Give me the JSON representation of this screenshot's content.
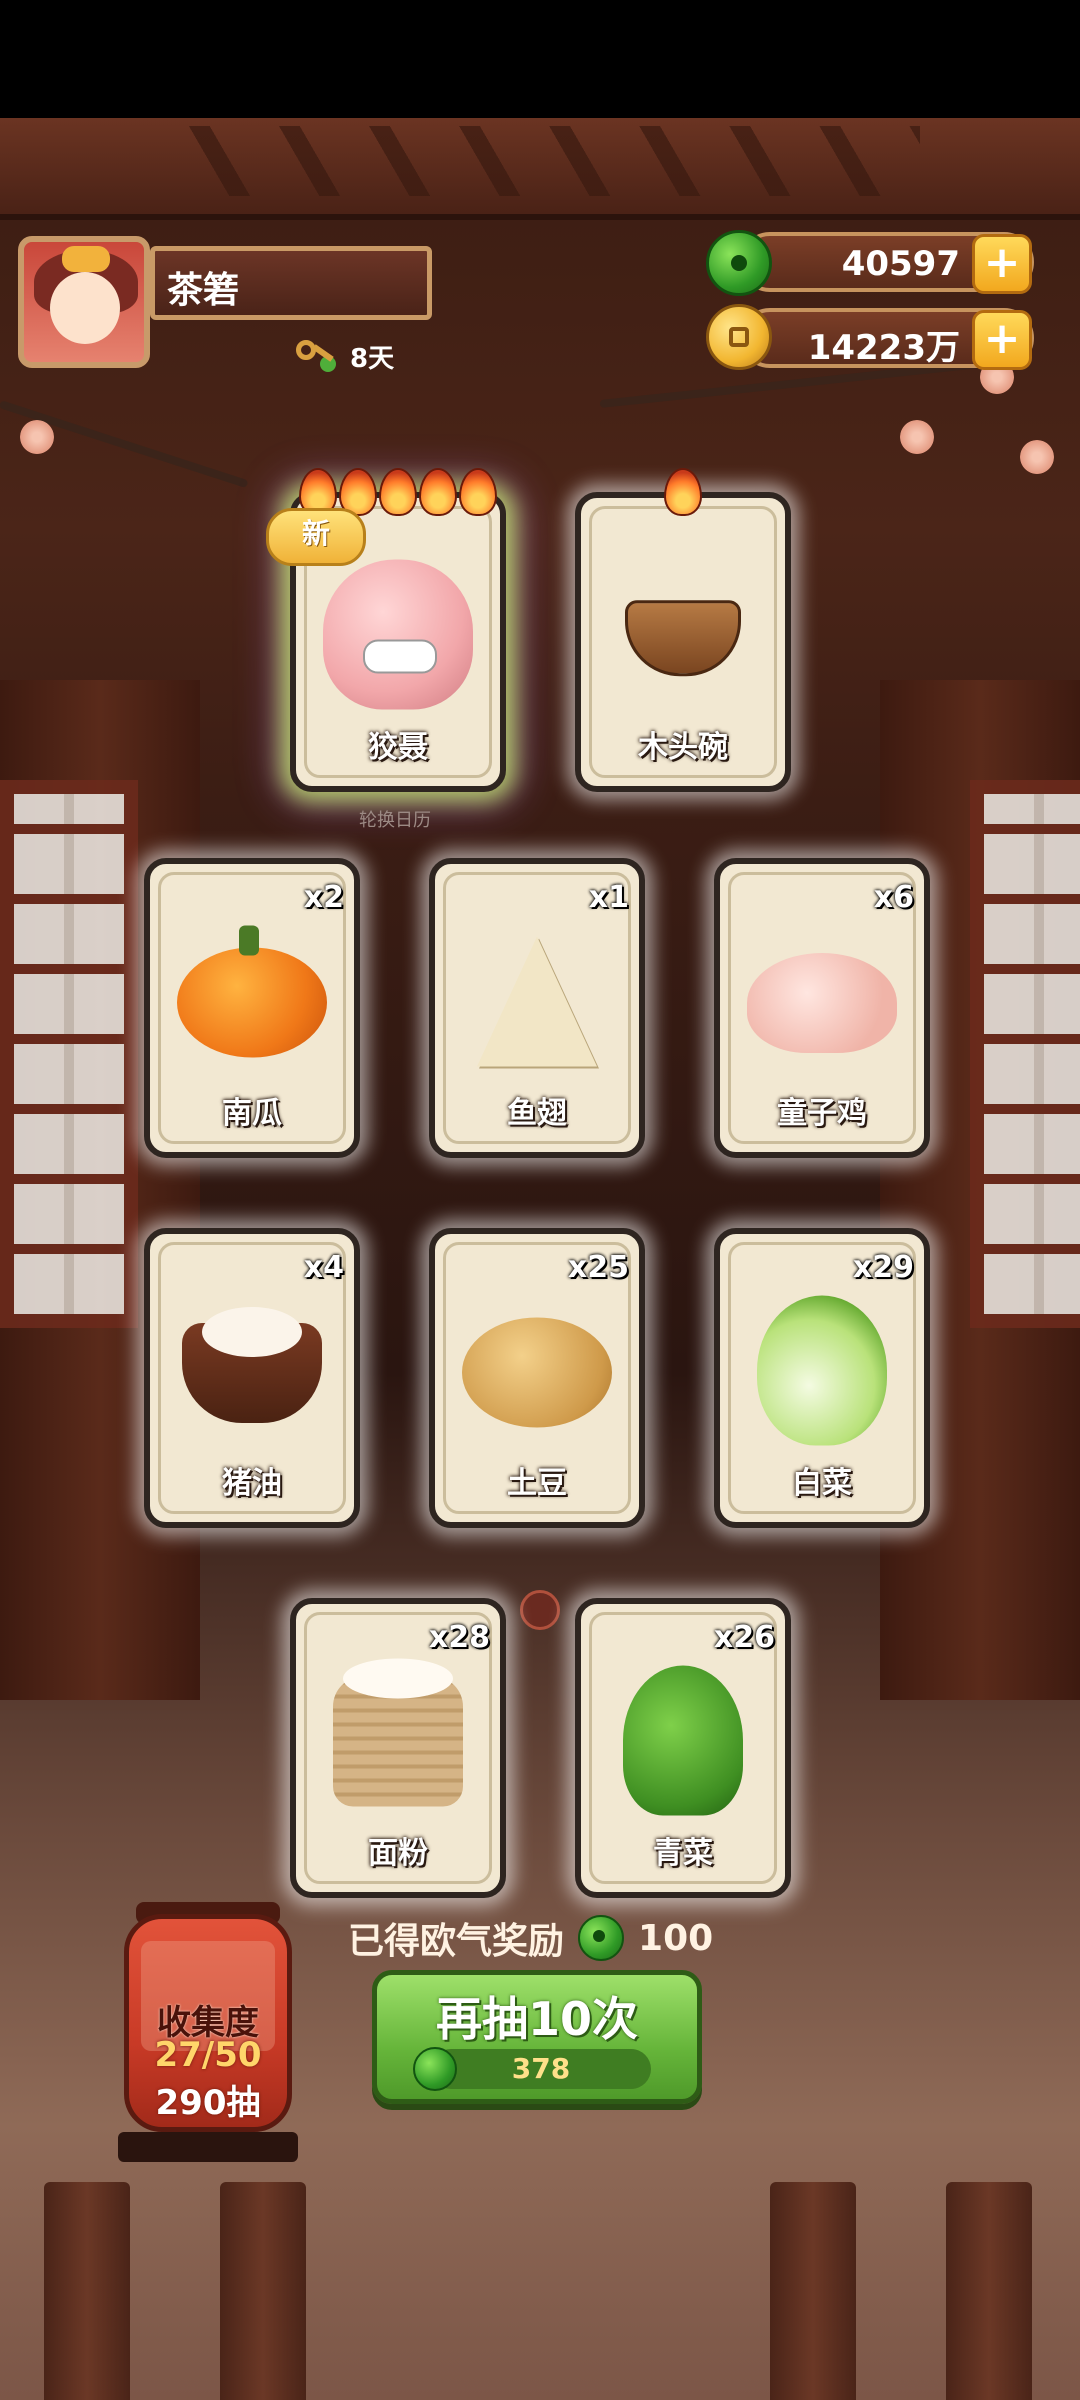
{
  "player": {
    "name": "茶箬",
    "days": "8天"
  },
  "currency": {
    "jade": "40597",
    "coins": "14223万",
    "plus": "+"
  },
  "top_cards": [
    {
      "label": "狡聂",
      "badge": "新",
      "flames": 5,
      "rare": true
    },
    {
      "label": "木头碗",
      "flames": 1,
      "rare": false
    }
  ],
  "hint": "轮换日历",
  "cards": [
    {
      "label": "南瓜",
      "qty": "x2"
    },
    {
      "label": "鱼翅",
      "qty": "x1"
    },
    {
      "label": "童子鸡",
      "qty": "x6"
    },
    {
      "label": "猪油",
      "qty": "x4"
    },
    {
      "label": "土豆",
      "qty": "x25"
    },
    {
      "label": "白菜",
      "qty": "x29"
    },
    {
      "label": "面粉",
      "qty": "x28"
    },
    {
      "label": "青菜",
      "qty": "x26"
    }
  ],
  "reward": {
    "text": "已得欧气奖励",
    "value": "100"
  },
  "draw": {
    "label": "再抽10次",
    "cost": "378"
  },
  "collection": {
    "title": "收集度",
    "count": "27/50",
    "draws": "290抽"
  },
  "colors": {
    "accent_green": "#66b53a",
    "card_bg": "#f2e8d2",
    "gold": "#f2a81e"
  }
}
